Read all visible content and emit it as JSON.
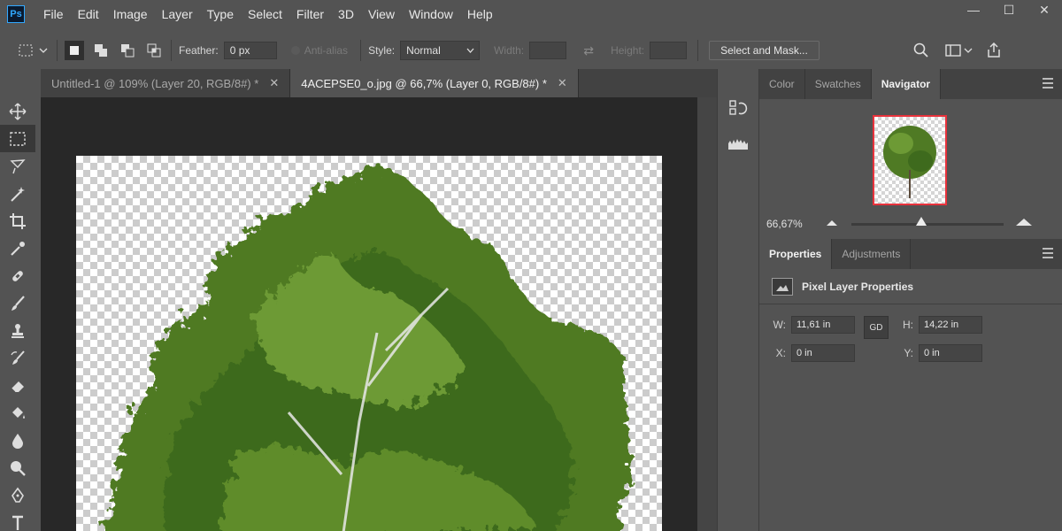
{
  "app": {
    "logo": "Ps"
  },
  "menu": [
    "File",
    "Edit",
    "Image",
    "Layer",
    "Type",
    "Select",
    "Filter",
    "3D",
    "View",
    "Window",
    "Help"
  ],
  "window_controls": {
    "minimize": "—",
    "maximize": "☐",
    "close": "✕"
  },
  "options": {
    "feather_label": "Feather:",
    "feather_value": "0 px",
    "antialias_label": "Anti-alias",
    "style_label": "Style:",
    "style_value": "Normal",
    "width_label": "Width:",
    "height_label": "Height:",
    "select_mask_label": "Select and Mask..."
  },
  "documents": {
    "tabs": [
      {
        "title": "Untitled-1 @ 109% (Layer 20, RGB/8#) *",
        "close": "✕"
      },
      {
        "title": "4ACEPSE0_o.jpg @ 66,7% (Layer 0, RGB/8#) *",
        "close": "✕"
      }
    ],
    "active_tab": 1
  },
  "navigator_panel": {
    "tabs": [
      "Color",
      "Swatches",
      "Navigator"
    ],
    "active_tab": "Navigator",
    "zoom": "66,67%",
    "zoom_slider_level": 0.46
  },
  "properties_panel": {
    "tabs": [
      "Properties",
      "Adjustments"
    ],
    "active_tab": "Properties",
    "title": "Pixel Layer Properties",
    "w_label": "W:",
    "w_value": "11,61 in",
    "h_label": "H:",
    "h_value": "14,22 in",
    "x_label": "X:",
    "x_value": "0 in",
    "y_label": "Y:",
    "y_value": "0 in",
    "link_label": "GD"
  },
  "colors": {
    "ui_bg": "#535353",
    "canvas_bg": "#282828",
    "thumb_border": "#e8323c",
    "foliage": "#4f7a24"
  },
  "tools": [
    "move-icon",
    "marquee-icon",
    "lasso-icon",
    "magic-wand-icon",
    "crop-icon",
    "eyedropper-icon",
    "healing-icon",
    "brush-icon",
    "stamp-icon",
    "history-brush-icon",
    "eraser-icon",
    "bucket-icon",
    "blur-icon",
    "dodge-icon",
    "pen-icon",
    "type-icon"
  ]
}
